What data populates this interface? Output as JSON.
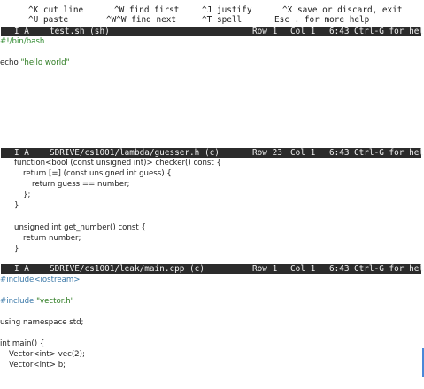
{
  "help": {
    "row1": [
      {
        "key": "^K",
        "label": "cut line"
      },
      {
        "key": "^W",
        "label": "find first"
      },
      {
        "key": "^J",
        "label": "justify"
      },
      {
        "key": "^X",
        "label": "save or discard, exit"
      }
    ],
    "row2": [
      {
        "key": "^U",
        "label": "paste"
      },
      {
        "key": "^W^W",
        "label": "find next"
      },
      {
        "key": "^T",
        "label": "spell"
      },
      {
        "key": "Esc .",
        "label": "for more help"
      }
    ]
  },
  "panes": [
    {
      "status": {
        "mode": "I A",
        "file": "test.sh (sh)",
        "row": "Row 1",
        "col": "Col 1",
        "time": "6:43",
        "help": "Ctrl-G for help"
      },
      "lines": [
        "#!/bin/bash",
        "",
        "echo \"hello world\""
      ]
    },
    {
      "status": {
        "mode": "I A",
        "file": "SDRIVE/cs1001/lambda/guesser.h (c)",
        "row": "Row 23",
        "col": "Col 1",
        "time": "6:43",
        "help": "Ctrl-G for help"
      },
      "lines": [
        "function<bool (const unsigned int)> checker() const {",
        "return [=] (const unsigned int guess) {",
        "return guess == number;",
        "};",
        "}",
        "",
        "unsigned int get_number() const {",
        "return number;",
        "}"
      ]
    },
    {
      "status": {
        "mode": "I A",
        "file": "SDRIVE/cs1001/leak/main.cpp (c)",
        "row": "Row 1",
        "col": "Col 1",
        "time": "6:43",
        "help": "Ctrl-G for help"
      },
      "lines": [
        "#include<iostream>",
        "",
        "#include \"vector.h\"",
        "",
        "using namespace std;",
        "",
        "int main() {",
        "Vector<int> vec(2);",
        "Vector<int> b;"
      ]
    }
  ],
  "colors": {
    "status_bg": "#2b2b2b",
    "string": "#2b7a1f",
    "preprocessor": "#3a78a8",
    "number": "#2b5cb8",
    "scrollbar": "#4a88d8"
  }
}
